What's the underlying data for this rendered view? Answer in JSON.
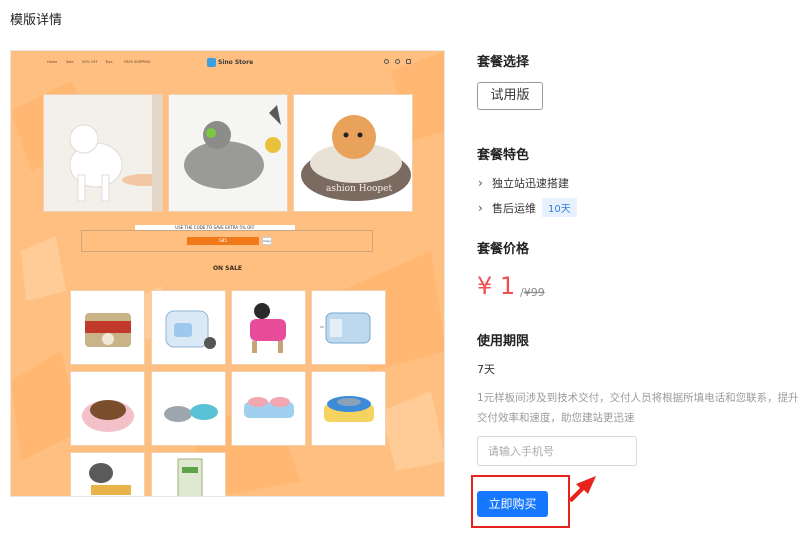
{
  "page_title": "模版详情",
  "preview": {
    "nav_items": [
      "Home",
      "Sale",
      "50% OFF",
      "Toys",
      "FREE SHIPPING"
    ],
    "logo": "Sino Store",
    "promo_text": "USE THE CODE TO SAVE EXTRA 5% OFF",
    "code": "SB5",
    "copy_label": "Copy",
    "section_title": "ON SALE",
    "colors": {
      "background": "#ffbf80",
      "code": "#f07a1a"
    }
  },
  "package": {
    "select_label": "套餐选择",
    "option": "试用版",
    "features_label": "套餐特色",
    "features": [
      {
        "text": "独立站迅速搭建"
      },
      {
        "text": "售后运维",
        "badge": "10天"
      }
    ],
    "price_label": "套餐价格",
    "price": "¥ 1",
    "price_sep": "/",
    "original_price": "¥99",
    "period_label": "使用期限",
    "period": "7天",
    "note": "1元样板间涉及到技术交付，交付人员将根据所填电话和您联系，提升交付效率和速度，助您建站更迅速",
    "phone_placeholder": "请输入手机号",
    "buy_label": "立即购买",
    "colors": {
      "price": "#f04f4f",
      "button": "#1677ff",
      "highlight": "#e8231e"
    }
  }
}
